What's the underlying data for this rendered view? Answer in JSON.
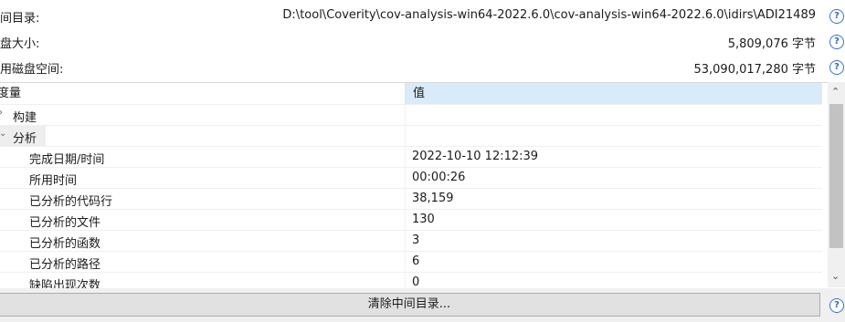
{
  "info": [
    {
      "label": "中间目录:",
      "value": "D:\\tool\\Coverity\\cov-analysis-win64-2022.6.0\\cov-analysis-win64-2022.6.0\\idirs\\ADI21489"
    },
    {
      "label": "磁盘大小:",
      "value": "5,809,076 字节"
    },
    {
      "label": "可用磁盘空间:",
      "value": "53,090,017,280 字节"
    }
  ],
  "help_glyph": "?",
  "table": {
    "headers": [
      "度量",
      "值"
    ],
    "rows": [
      {
        "label": "构建",
        "value": "",
        "level": 0,
        "expander": "›"
      },
      {
        "label": "分析",
        "value": "",
        "level": 0,
        "expander": "⌄"
      },
      {
        "label": "完成日期/时间",
        "value": "2022-10-10 12:12:39",
        "level": 1
      },
      {
        "label": "所用时间",
        "value": "00:00:26",
        "level": 1
      },
      {
        "label": "已分析的代码行",
        "value": "38,159",
        "level": 1
      },
      {
        "label": "已分析的文件",
        "value": "130",
        "level": 1
      },
      {
        "label": "已分析的函数",
        "value": "3",
        "level": 1
      },
      {
        "label": "已分析的路径",
        "value": "6",
        "level": 1
      },
      {
        "label": "缺陷出现次数",
        "value": "0",
        "level": 1
      }
    ]
  },
  "scrollbar": {
    "up": "⌃",
    "down": "⌄"
  },
  "footer": {
    "clear_button": "清除中间目录..."
  }
}
